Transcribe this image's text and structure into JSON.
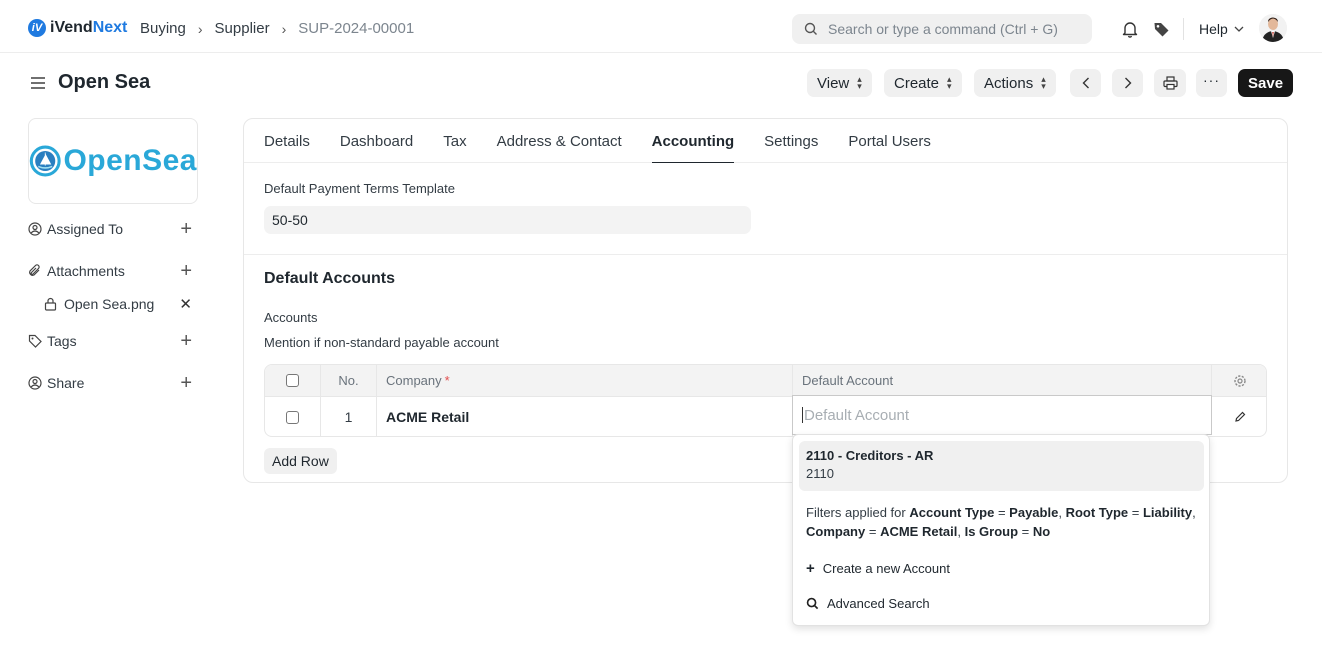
{
  "app": {
    "brand_main": "iVend",
    "brand_accent": "Next",
    "brand_mark": "iV"
  },
  "breadcrumbs": [
    "Buying",
    "Supplier",
    "SUP-2024-00001"
  ],
  "search": {
    "placeholder": "Search or type a command (Ctrl + G)"
  },
  "help_label": "Help",
  "page": {
    "title": "Open Sea"
  },
  "toolbar": {
    "view": "View",
    "create": "Create",
    "actions": "Actions",
    "save": "Save"
  },
  "sidebar": {
    "logo_text": "OpenSea",
    "assigned_to": "Assigned To",
    "attachments": "Attachments",
    "attachment_file": "Open Sea.png",
    "tags": "Tags",
    "share": "Share"
  },
  "tabs": [
    "Details",
    "Dashboard",
    "Tax",
    "Address & Contact",
    "Accounting",
    "Settings",
    "Portal Users"
  ],
  "active_tab": "Accounting",
  "form": {
    "payment_terms_label": "Default Payment Terms Template",
    "payment_terms_value": "50-50",
    "section_title": "Default Accounts",
    "accounts_label": "Accounts",
    "accounts_desc": "Mention if non-standard payable account"
  },
  "grid": {
    "headers": {
      "no": "No.",
      "company": "Company",
      "required_mark": "*",
      "default_account": "Default Account"
    },
    "rows": [
      {
        "no": "1",
        "company": "ACME Retail",
        "default_account_placeholder": "Default Account"
      }
    ],
    "add_row": "Add Row"
  },
  "dropdown": {
    "option_title": "2110 - Creditors - AR",
    "option_sub": "2110",
    "filter_prefix": "Filters applied for",
    "filters": [
      {
        "field": "Account Type",
        "value": "Payable"
      },
      {
        "field": "Root Type",
        "value": "Liability"
      },
      {
        "field": "Company",
        "value": "ACME Retail"
      },
      {
        "field": "Is Group",
        "value": "No"
      }
    ],
    "create_new": "Create a new Account",
    "advanced_search": "Advanced Search"
  },
  "colors": {
    "brand_blue": "#1f7ae0",
    "logo_teal": "#2aa8d8",
    "save_bg": "#171717",
    "required_red": "#e24c4c"
  }
}
